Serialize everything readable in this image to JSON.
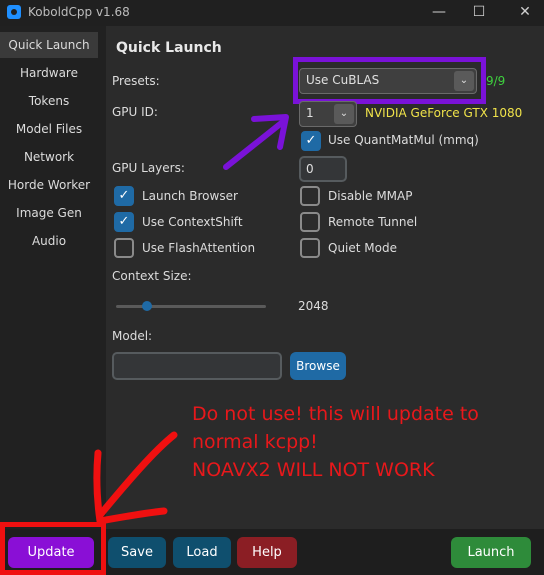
{
  "window": {
    "title": "KoboldCpp v1.68"
  },
  "sidebar": {
    "items": [
      {
        "label": "Quick Launch",
        "active": true
      },
      {
        "label": "Hardware"
      },
      {
        "label": "Tokens"
      },
      {
        "label": "Model Files"
      },
      {
        "label": "Network"
      },
      {
        "label": "Horde Worker"
      },
      {
        "label": "Image Gen"
      },
      {
        "label": "Audio"
      }
    ]
  },
  "main": {
    "title": "Quick Launch",
    "presets_label": "Presets:",
    "presets_value": "Use CuBLAS",
    "gpu_layers_count": "9/9",
    "gpu_id_label": "GPU ID:",
    "gpu_id_value": "1",
    "gpu_name": "NVIDIA GeForce GTX 1080",
    "mmq_label": "Use QuantMatMul (mmq)",
    "gpu_layers_label": "GPU Layers:",
    "gpu_layers_value": "0",
    "checkboxes": {
      "launch_browser": "Launch Browser",
      "disable_mmap": "Disable MMAP",
      "context_shift": "Use ContextShift",
      "remote_tunnel": "Remote Tunnel",
      "flash_attention": "Use FlashAttention",
      "quiet_mode": "Quiet Mode"
    },
    "context_size_label": "Context Size:",
    "context_size_value": "2048",
    "model_label": "Model:",
    "browse_label": "Browse"
  },
  "annotation": {
    "line1": "Do not use! this will update to",
    "line2": "normal kcpp!",
    "line3": "NOAVX2 WILL NOT WORK"
  },
  "footer": {
    "update": "Update",
    "save": "Save",
    "load": "Load",
    "help": "Help",
    "launch": "Launch"
  },
  "colors": {
    "accent": "#1f6aa5",
    "update_button": "#8a0fd6",
    "save_button": "#0f4f6e",
    "help_button": "#8b1e24",
    "launch_button": "#2e8b3a",
    "annotation_red": "#e8181b",
    "annotation_purple": "#7a12d8"
  }
}
